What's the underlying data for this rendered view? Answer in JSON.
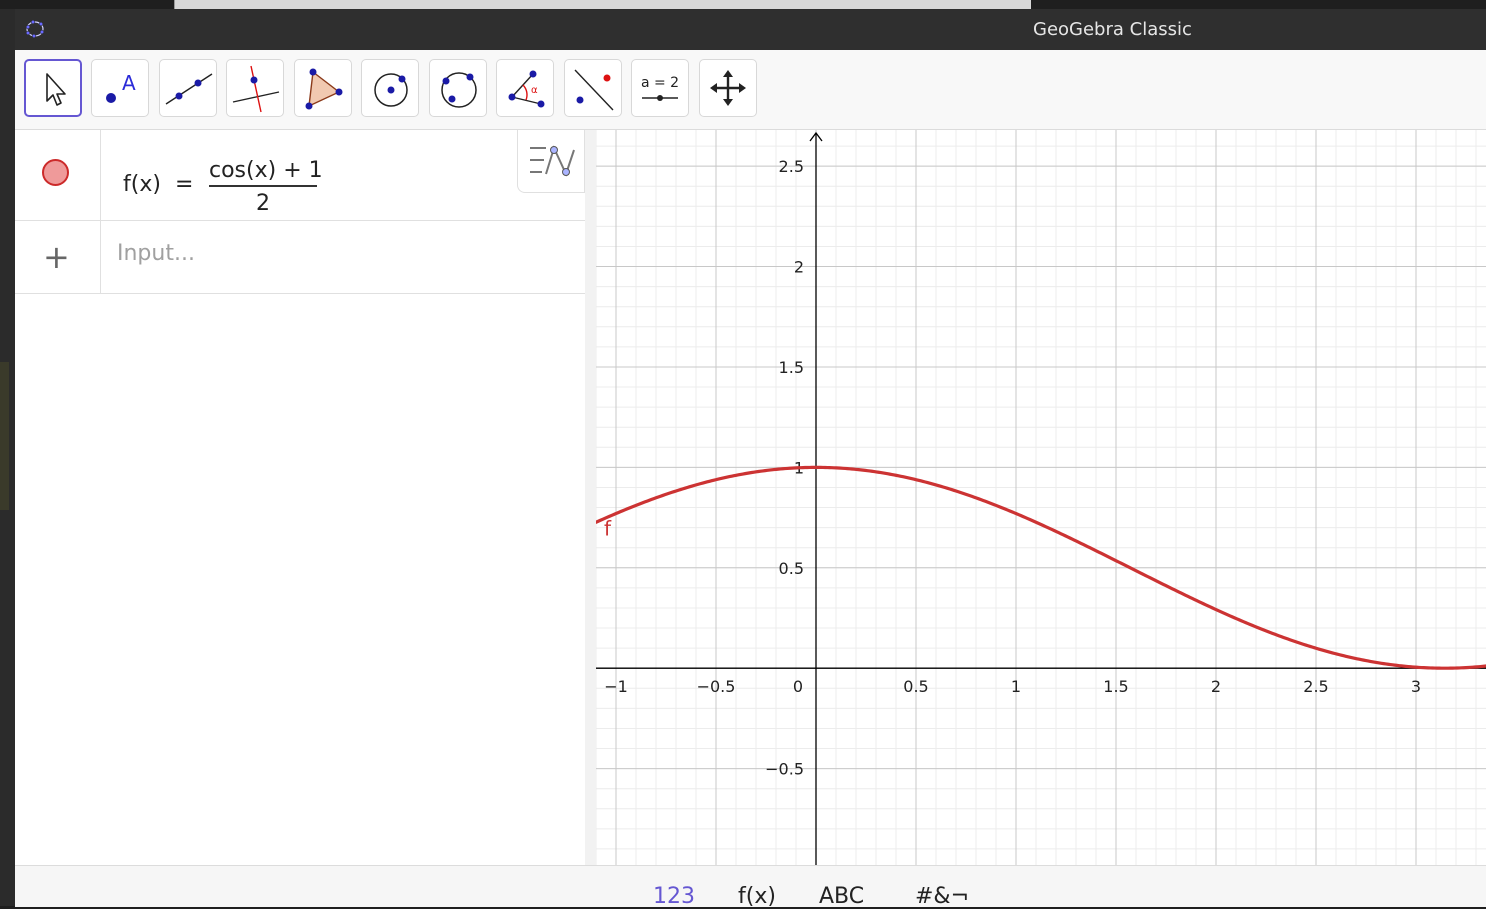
{
  "window": {
    "title": "GeoGebra Classic"
  },
  "toolbar": {
    "tools": [
      {
        "name": "move-tool"
      },
      {
        "name": "point-tool",
        "label": "A"
      },
      {
        "name": "line-tool"
      },
      {
        "name": "perpendicular-line-tool"
      },
      {
        "name": "polygon-tool"
      },
      {
        "name": "circle-center-point-tool"
      },
      {
        "name": "circle-three-points-tool"
      },
      {
        "name": "angle-tool",
        "label": "α"
      },
      {
        "name": "reflect-about-line-tool"
      },
      {
        "name": "slider-tool",
        "label": "a = 2"
      },
      {
        "name": "move-graphics-view-tool"
      }
    ]
  },
  "algebra": {
    "entries": [
      {
        "lhs": "f(x)",
        "eq": "=",
        "numerator": "cos(x) + 1",
        "denominator": "2",
        "color": "#cc3333"
      }
    ],
    "input_placeholder": "Input..."
  },
  "graphics": {
    "function_label": "f",
    "curve_color": "#cc3333",
    "x_ticks": [
      "−1",
      "−0.5",
      "0",
      "0.5",
      "1",
      "1.5",
      "2",
      "2.5",
      "3"
    ],
    "y_ticks": [
      "2.5",
      "2",
      "1.5",
      "1",
      "0.5",
      "−0.5"
    ]
  },
  "chart_data": {
    "type": "line",
    "series": [
      {
        "name": "f",
        "expression": "(cos(x) + 1) / 2"
      }
    ],
    "xlim": [
      -1.1,
      3.35
    ],
    "ylim": [
      -0.98,
      2.68
    ],
    "x_ticks": [
      -1,
      -0.5,
      0,
      0.5,
      1,
      1.5,
      2,
      2.5,
      3
    ],
    "y_ticks": [
      -0.5,
      0.5,
      1,
      1.5,
      2,
      2.5
    ],
    "grid": true
  },
  "keyboard": {
    "tabs": [
      "123",
      "f(x)",
      "ABC",
      "#&¬"
    ]
  }
}
